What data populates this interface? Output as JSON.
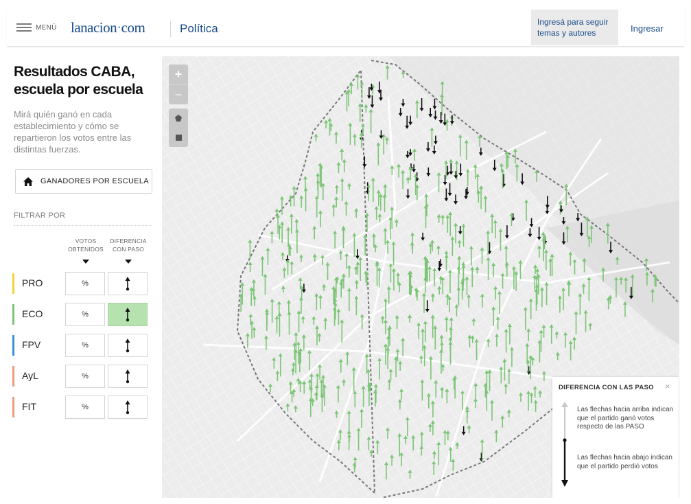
{
  "header": {
    "menu_label": "MENÚ",
    "logo_text": "lanacion",
    "logo_suffix": "com",
    "section": "Política",
    "login_prompt": "Ingresá para seguir temas y autores",
    "login_link": "Ingresar"
  },
  "sidebar": {
    "title": "Resultados CABA, escuela por escuela",
    "subtitle": "Mirá quién ganó en cada establecimiento y cómo se repartieron los votos entre las distintas fuerzas.",
    "winners_button": "GANADORES POR ESCUELA",
    "filter_label": "FILTRAR POR",
    "col_votes": "VOTOS OBTENIDOS",
    "col_diff": "DIFERENCIA CON PASO",
    "pct_symbol": "%",
    "parties": [
      {
        "name": "PRO",
        "color": "#f2d338",
        "active": false
      },
      {
        "name": "ECO",
        "color": "#7cc576",
        "active": true
      },
      {
        "name": "FPV",
        "color": "#3a8fd9",
        "active": false
      },
      {
        "name": "AyL",
        "color": "#ef9b83",
        "active": false
      },
      {
        "name": "FIT",
        "color": "#ef9b83",
        "active": false
      }
    ]
  },
  "map": {
    "zoom_in": "+",
    "zoom_out": "−",
    "up_arrow_color": "#7cc576",
    "down_arrow_color": "#111111"
  },
  "legend": {
    "title": "DIFERENCIA CON LAS PASO",
    "close": "×",
    "up_text": "Las flechas hacia arriba indican que el partido ganó votos respecto de las PASO",
    "down_text": "Las flechas hacia abajo indican que el partido perdió votos"
  }
}
